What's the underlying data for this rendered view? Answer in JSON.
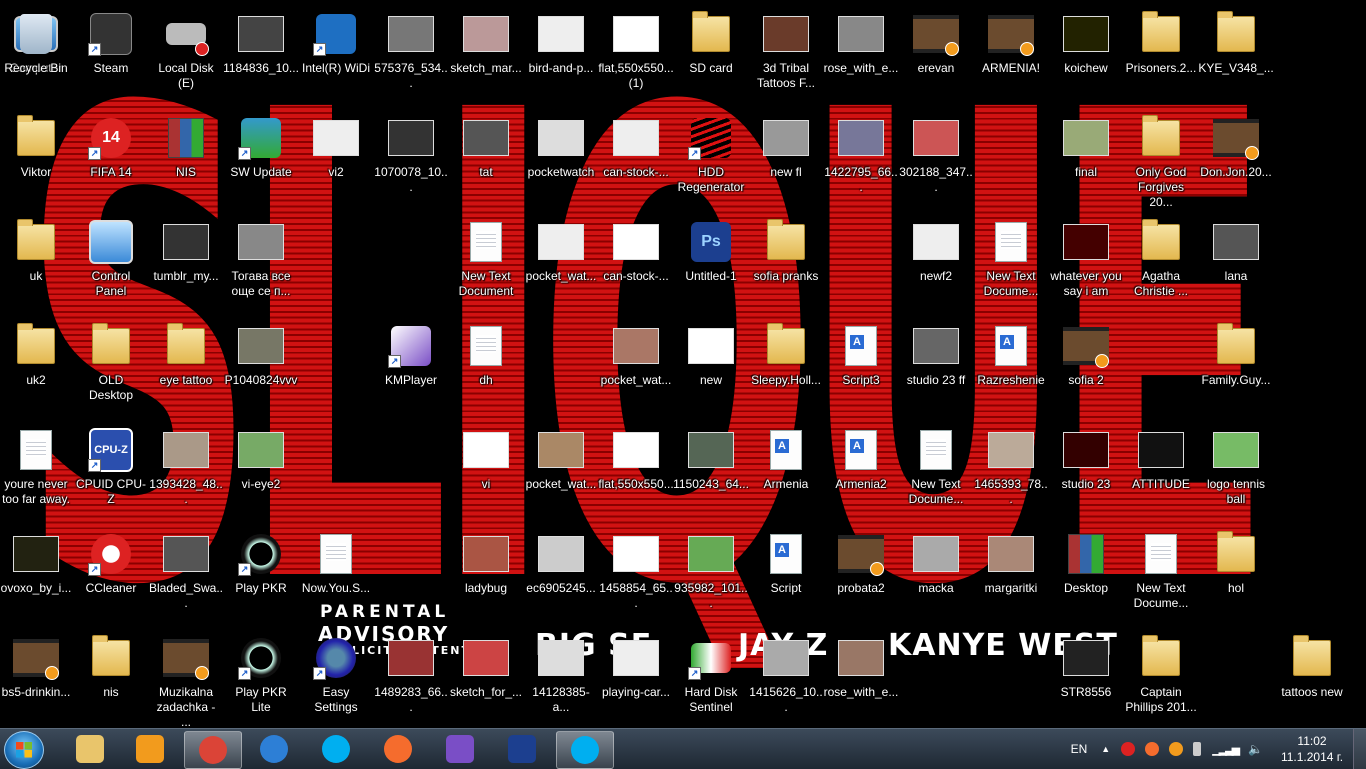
{
  "wallpaper": {
    "word": "SLIQUE",
    "parental_top": "PARENTAL",
    "parental_mid": "ADVISORY",
    "parental_bottom": "EXPLICIT CONTENT",
    "album_big_sean": "BIG SE",
    "album_jay_z": "JAY Z",
    "album_kanye": "KANYE WEST"
  },
  "icons": [
    {
      "label": "Computer",
      "kind": "computer"
    },
    {
      "label": "Steam",
      "kind": "steam",
      "shortcut": true
    },
    {
      "label": "Local Disk (E)",
      "kind": "disk"
    },
    {
      "label": "1184836_10...",
      "kind": "img",
      "color": "#444"
    },
    {
      "label": "Intel(R) WiDi",
      "kind": "widi",
      "shortcut": true
    },
    {
      "label": "575376_534...",
      "kind": "img",
      "color": "#777"
    },
    {
      "label": "sketch_mar...",
      "kind": "img",
      "color": "#b99"
    },
    {
      "label": "bird-and-p...",
      "kind": "img",
      "color": "#eee"
    },
    {
      "label": "flat,550x550...\n(1)",
      "kind": "img",
      "color": "#fff"
    },
    {
      "label": "SD card",
      "kind": "folder"
    },
    {
      "label": "3d Tribal Tattoos F...",
      "kind": "img",
      "color": "#6a3b2a"
    },
    {
      "label": "rose_with_e...",
      "kind": "img",
      "color": "#888"
    },
    {
      "label": "erevan",
      "kind": "video"
    },
    {
      "label": "ARMENIA!",
      "kind": "video"
    },
    {
      "label": "koichew",
      "kind": "img",
      "color": "#220"
    },
    {
      "label": "Prisoners.2...",
      "kind": "folder"
    },
    {
      "label": "KYE_V348_...",
      "kind": "folder"
    },
    {
      "label": "Viktor",
      "kind": "folder"
    },
    {
      "label": "FIFA 14",
      "kind": "fifa",
      "shortcut": true
    },
    {
      "label": "NIS",
      "kind": "rar"
    },
    {
      "label": "SW Update",
      "kind": "swupdate",
      "shortcut": true
    },
    {
      "label": "vi2",
      "kind": "img",
      "color": "#eee"
    },
    {
      "label": "1070078_10...",
      "kind": "img",
      "color": "#333"
    },
    {
      "label": "tat",
      "kind": "img",
      "color": "#555"
    },
    {
      "label": "pocketwatch",
      "kind": "img",
      "color": "#ddd"
    },
    {
      "label": "can-stock-...",
      "kind": "img",
      "color": "#eee"
    },
    {
      "label": "HDD Regenerator",
      "kind": "hdd",
      "shortcut": true
    },
    {
      "label": "new fl",
      "kind": "img",
      "color": "#999"
    },
    {
      "label": "1422795_66...",
      "kind": "img",
      "color": "#779"
    },
    {
      "label": "302188_347...",
      "kind": "img",
      "color": "#c55"
    },
    {
      "label": "final",
      "kind": "img",
      "color": "#9a7"
    },
    {
      "label": "Only God Forgives 20...",
      "kind": "folder"
    },
    {
      "label": "Don.Jon.20...",
      "kind": "video"
    },
    {
      "label": "uk",
      "kind": "folder"
    },
    {
      "label": "Control Panel",
      "kind": "control"
    },
    {
      "label": "tumblr_my...",
      "kind": "img",
      "color": "#333"
    },
    {
      "label": "Тогава все още се п...",
      "kind": "img",
      "color": "#888"
    },
    {
      "label": "New Text Document",
      "kind": "doc"
    },
    {
      "label": "pocket_wat...",
      "kind": "img",
      "color": "#eee"
    },
    {
      "label": "can-stock-...",
      "kind": "img",
      "color": "#fff"
    },
    {
      "label": "Untitled-1",
      "kind": "psd"
    },
    {
      "label": "sofia pranks",
      "kind": "folder"
    },
    {
      "label": "newf2",
      "kind": "img",
      "color": "#eee"
    },
    {
      "label": "New Text Docume...",
      "kind": "doc"
    },
    {
      "label": "whatever you say i am",
      "kind": "img",
      "color": "#400"
    },
    {
      "label": "Agatha Christie ...",
      "kind": "folder"
    },
    {
      "label": "lana",
      "kind": "img",
      "color": "#555"
    },
    {
      "label": "uk2",
      "kind": "folder"
    },
    {
      "label": "OLD Desktop",
      "kind": "folder"
    },
    {
      "label": "eye tattoo",
      "kind": "folder"
    },
    {
      "label": "P1040824vvv",
      "kind": "img",
      "color": "#776"
    },
    {
      "label": "KMPlayer",
      "kind": "kmp",
      "shortcut": true
    },
    {
      "label": "dh",
      "kind": "doc"
    },
    {
      "label": "pocket_wat...",
      "kind": "img",
      "color": "#a76"
    },
    {
      "label": "new",
      "kind": "img",
      "color": "#fff"
    },
    {
      "label": "Sleepy.Holl...",
      "kind": "folder"
    },
    {
      "label": "Script3",
      "kind": "word"
    },
    {
      "label": "studio 23 ff",
      "kind": "img",
      "color": "#666"
    },
    {
      "label": "Razreshenie",
      "kind": "word"
    },
    {
      "label": "sofia 2",
      "kind": "video"
    },
    {
      "label": "Family.Guy...",
      "kind": "folder"
    },
    {
      "label": "youre never too far away.",
      "kind": "doc"
    },
    {
      "label": "CPUID CPU-Z",
      "kind": "cpuz",
      "shortcut": true
    },
    {
      "label": "1393428_48...",
      "kind": "img",
      "color": "#a98"
    },
    {
      "label": "vi-eye2",
      "kind": "img",
      "color": "#7a6"
    },
    {
      "label": "vi",
      "kind": "img",
      "color": "#fff"
    },
    {
      "label": "pocket_wat...",
      "kind": "img",
      "color": "#a86"
    },
    {
      "label": "flat,550x550...",
      "kind": "img",
      "color": "#fff"
    },
    {
      "label": "1150243_64...",
      "kind": "img",
      "color": "#565"
    },
    {
      "label": "Armenia",
      "kind": "word"
    },
    {
      "label": "Armenia2",
      "kind": "word"
    },
    {
      "label": "New Text Docume...",
      "kind": "doc"
    },
    {
      "label": "1465393_78...",
      "kind": "img",
      "color": "#ba9"
    },
    {
      "label": "studio 23",
      "kind": "img",
      "color": "#300"
    },
    {
      "label": "ATTITUDE",
      "kind": "img",
      "color": "#111"
    },
    {
      "label": "logo tennis ball",
      "kind": "img",
      "color": "#7b6"
    },
    {
      "label": "ovoxo_by_i...",
      "kind": "img",
      "color": "#221"
    },
    {
      "label": "CCleaner",
      "kind": "ccleaner",
      "shortcut": true
    },
    {
      "label": "Bladed_Swa...",
      "kind": "img",
      "color": "#555"
    },
    {
      "label": "Play PKR",
      "kind": "pkr",
      "shortcut": true
    },
    {
      "label": "Now.You.S...",
      "kind": "doc"
    },
    {
      "label": "ladybug",
      "kind": "img",
      "color": "#a54"
    },
    {
      "label": "ec6905245...",
      "kind": "img",
      "color": "#ccc"
    },
    {
      "label": "1458854_65...",
      "kind": "img",
      "color": "#fff"
    },
    {
      "label": "935982_101...",
      "kind": "img",
      "color": "#6a5"
    },
    {
      "label": "Script",
      "kind": "word"
    },
    {
      "label": "probata2",
      "kind": "video"
    },
    {
      "label": "macka",
      "kind": "img",
      "color": "#aaa"
    },
    {
      "label": "margaritki",
      "kind": "img",
      "color": "#a87"
    },
    {
      "label": "Desktop",
      "kind": "rar"
    },
    {
      "label": "New Text Docume...",
      "kind": "doc"
    },
    {
      "label": "hol",
      "kind": "folder"
    },
    {
      "label": "bs5-drinkin...",
      "kind": "video"
    },
    {
      "label": "nis",
      "kind": "folder"
    },
    {
      "label": "Muzikalna zadachka - ...",
      "kind": "video"
    },
    {
      "label": "Play PKR Lite",
      "kind": "pkr",
      "shortcut": true
    },
    {
      "label": "Easy Settings",
      "kind": "easy",
      "shortcut": true
    },
    {
      "label": "1489283_66...",
      "kind": "img",
      "color": "#933"
    },
    {
      "label": "sketch_for_...",
      "kind": "img",
      "color": "#c44"
    },
    {
      "label": "14128385-a...",
      "kind": "img",
      "color": "#ddd"
    },
    {
      "label": "playing-car...",
      "kind": "img",
      "color": "#eee"
    },
    {
      "label": "Hard Disk Sentinel",
      "kind": "hds",
      "shortcut": true
    },
    {
      "label": "1415626_10...",
      "kind": "img",
      "color": "#aaa"
    },
    {
      "label": "rose_with_e...",
      "kind": "img",
      "color": "#976"
    },
    {
      "label": "STR8556",
      "kind": "img",
      "color": "#222"
    },
    {
      "label": "Captain Phillips 201...",
      "kind": "folder"
    },
    {
      "label": "tattoos new",
      "kind": "folder"
    },
    {
      "label": "Recycle Bin",
      "kind": "bin"
    }
  ],
  "taskbar": {
    "apps": [
      {
        "name": "explorer",
        "color": "#e9c56b"
      },
      {
        "name": "media-player",
        "color": "#f29b1d"
      },
      {
        "name": "chrome",
        "color": "#db4437",
        "active": true
      },
      {
        "name": "thunder",
        "color": "#2d7fd6"
      },
      {
        "name": "skype",
        "color": "#00aff0"
      },
      {
        "name": "origin",
        "color": "#f56c2d"
      },
      {
        "name": "visual-studio",
        "color": "#7a4ec6"
      },
      {
        "name": "photoshop",
        "color": "#1c3f8f"
      },
      {
        "name": "skype-chat",
        "color": "#00aff0",
        "active": true
      }
    ],
    "language": "EN",
    "time": "11:02",
    "date": "11.1.2014 г."
  }
}
